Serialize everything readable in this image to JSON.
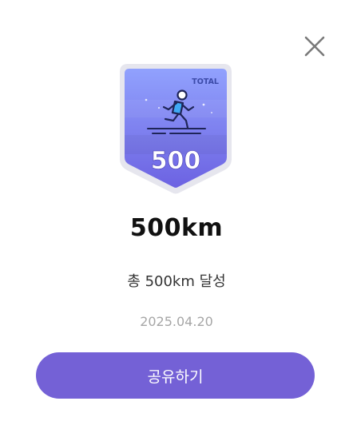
{
  "badge": {
    "tag": "TOTAL",
    "number": "500",
    "icon": "runner-icon",
    "colors": {
      "top": "#8fa0ff",
      "bottom": "#6b5fe0",
      "frame": "#e6e6ee",
      "accent": "#3fa9f5"
    }
  },
  "title": "500km",
  "description": "총 500km 달성",
  "date": "2025.04.20",
  "share_button": {
    "label": "공유하기",
    "color": "#7461d6"
  },
  "close_button": {
    "icon": "close-icon"
  }
}
